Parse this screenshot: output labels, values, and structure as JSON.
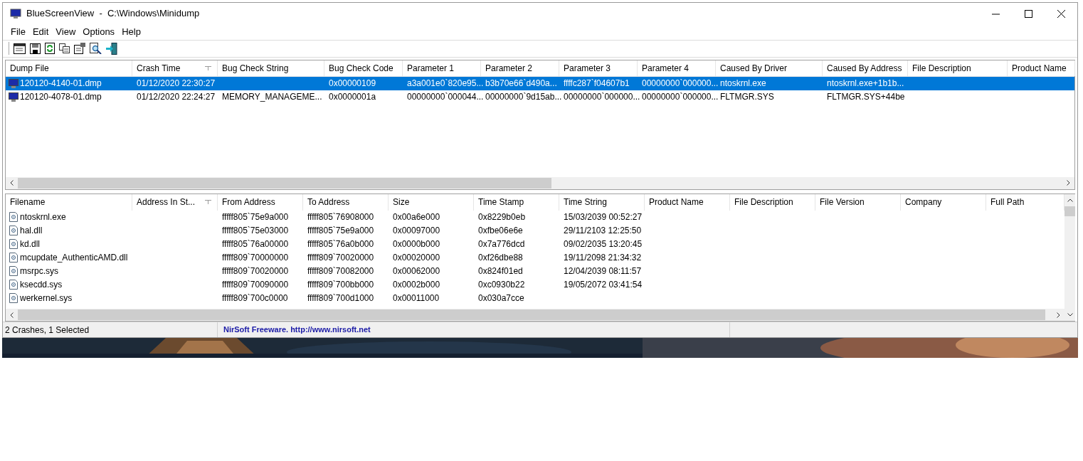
{
  "window": {
    "title": "BlueScreenView  -  C:\\Windows\\Minidump"
  },
  "menu": [
    "File",
    "Edit",
    "View",
    "Options",
    "Help"
  ],
  "crash_list": {
    "columns": [
      {
        "label": "Dump File",
        "sorted": false
      },
      {
        "label": "Crash Time",
        "sorted": true
      },
      {
        "label": "Bug Check String",
        "sorted": false
      },
      {
        "label": "Bug Check Code",
        "sorted": false
      },
      {
        "label": "Parameter 1",
        "sorted": false
      },
      {
        "label": "Parameter 2",
        "sorted": false
      },
      {
        "label": "Parameter 3",
        "sorted": false
      },
      {
        "label": "Parameter 4",
        "sorted": false
      },
      {
        "label": "Caused By Driver",
        "sorted": false
      },
      {
        "label": "Caused By Address",
        "sorted": false
      },
      {
        "label": "File Description",
        "sorted": false
      },
      {
        "label": "Product Name",
        "sorted": false
      }
    ],
    "rows": [
      {
        "selected": true,
        "cells": [
          "120120-4140-01.dmp",
          "01/12/2020 22:30:27",
          "",
          "0x00000109",
          "a3a001e0`820e95...",
          "b3b70e66`d490a...",
          "ffffc287`f04607b1",
          "00000000`000000...",
          "ntoskrnl.exe",
          "ntoskrnl.exe+1b1b...",
          "",
          ""
        ]
      },
      {
        "selected": false,
        "cells": [
          "120120-4078-01.dmp",
          "01/12/2020 22:24:27",
          "MEMORY_MANAGEME...",
          "0x0000001a",
          "00000000`000044...",
          "00000000`9d15ab...",
          "00000000`000000...",
          "00000000`000000...",
          "FLTMGR.SYS",
          "FLTMGR.SYS+44be",
          "",
          ""
        ]
      }
    ]
  },
  "module_list": {
    "columns": [
      {
        "label": "Filename",
        "sorted": false
      },
      {
        "label": "Address In St...",
        "sorted": true
      },
      {
        "label": "From Address",
        "sorted": false
      },
      {
        "label": "To Address",
        "sorted": false
      },
      {
        "label": "Size",
        "sorted": false
      },
      {
        "label": "Time Stamp",
        "sorted": false
      },
      {
        "label": "Time String",
        "sorted": false
      },
      {
        "label": "Product Name",
        "sorted": false
      },
      {
        "label": "File Description",
        "sorted": false
      },
      {
        "label": "File Version",
        "sorted": false
      },
      {
        "label": "Company",
        "sorted": false
      },
      {
        "label": "Full Path",
        "sorted": false
      }
    ],
    "rows": [
      {
        "cells": [
          "ntoskrnl.exe",
          "",
          "fffff805`75e9a000",
          "fffff805`76908000",
          "0x00a6e000",
          "0x8229b0eb",
          "15/03/2039 00:52:27"
        ]
      },
      {
        "cells": [
          "hal.dll",
          "",
          "fffff805`75e03000",
          "fffff805`75e9a000",
          "0x00097000",
          "0xfbe06e6e",
          "29/11/2103 12:25:50"
        ]
      },
      {
        "cells": [
          "kd.dll",
          "",
          "fffff805`76a00000",
          "fffff805`76a0b000",
          "0x0000b000",
          "0x7a776dcd",
          "09/02/2035 13:20:45"
        ]
      },
      {
        "cells": [
          "mcupdate_AuthenticAMD.dll",
          "",
          "fffff809`70000000",
          "fffff809`70020000",
          "0x00020000",
          "0xf26dbe88",
          "19/11/2098 21:34:32"
        ]
      },
      {
        "cells": [
          "msrpc.sys",
          "",
          "fffff809`70020000",
          "fffff809`70082000",
          "0x00062000",
          "0x824f01ed",
          "12/04/2039 08:11:57"
        ]
      },
      {
        "cells": [
          "ksecdd.sys",
          "",
          "fffff809`70090000",
          "fffff809`700bb000",
          "0x0002b000",
          "0xc0930b22",
          "19/05/2072 03:41:54"
        ]
      },
      {
        "cells": [
          "werkernel.sys",
          "",
          "fffff809`700c0000",
          "fffff809`700d1000",
          "0x00011000",
          "0x030a7cce",
          ""
        ]
      }
    ]
  },
  "status_bar": {
    "summary": "2 Crashes, 1 Selected",
    "link": "NirSoft Freeware.  http://www.nirsoft.net"
  }
}
